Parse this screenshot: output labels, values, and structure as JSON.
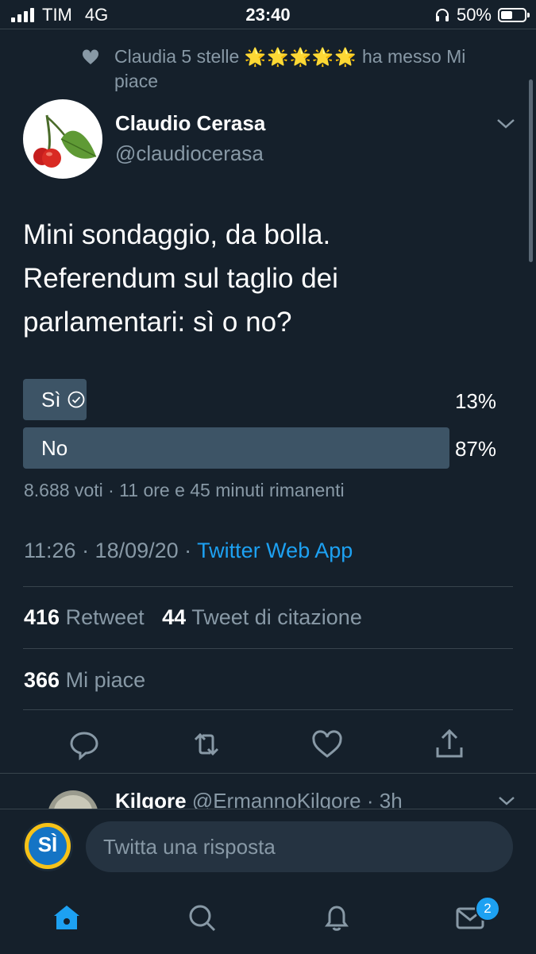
{
  "status_bar": {
    "carrier": "TIM",
    "network": "4G",
    "time": "23:40",
    "battery": "50%"
  },
  "social_context": {
    "text_before_stars": "Claudia 5 stelle",
    "stars": "🌟🌟🌟🌟🌟",
    "text_after_stars": "ha messo Mi piace"
  },
  "tweet": {
    "author_name": "Claudio Cerasa",
    "author_handle": "@claudiocerasa",
    "text_lines": [
      "Mini sondaggio, da bolla.",
      "Referendum sul taglio dei",
      "parlamentari: sì o no?"
    ],
    "poll": {
      "options": [
        {
          "label": "Sì",
          "percent": "13%",
          "fraction": 0.13,
          "voted": true
        },
        {
          "label": "No",
          "percent": "87%",
          "fraction": 0.87,
          "voted": false
        }
      ],
      "meta": "8.688 voti · 11 ore e 45 minuti rimanenti"
    },
    "timestamp": "11:26 · 18/09/20 · ",
    "source": "Twitter Web App",
    "retweets_count": "416",
    "retweets_label": "Retweet",
    "quotes_count": "44",
    "quotes_label": "Tweet di citazione",
    "likes_count": "366",
    "likes_label": "Mi piace"
  },
  "reply_preview": {
    "name": "Kilgore",
    "handle": "@ErmannoKilgore",
    "time": "· 3h"
  },
  "composer": {
    "avatar_text": "SÌ",
    "placeholder": "Twitta una risposta"
  },
  "tab_bar": {
    "messages_badge": "2"
  },
  "colors": {
    "background": "#15202b",
    "accent": "#1da1f2",
    "muted": "#8899a6",
    "poll_bar": "#3d5466"
  }
}
